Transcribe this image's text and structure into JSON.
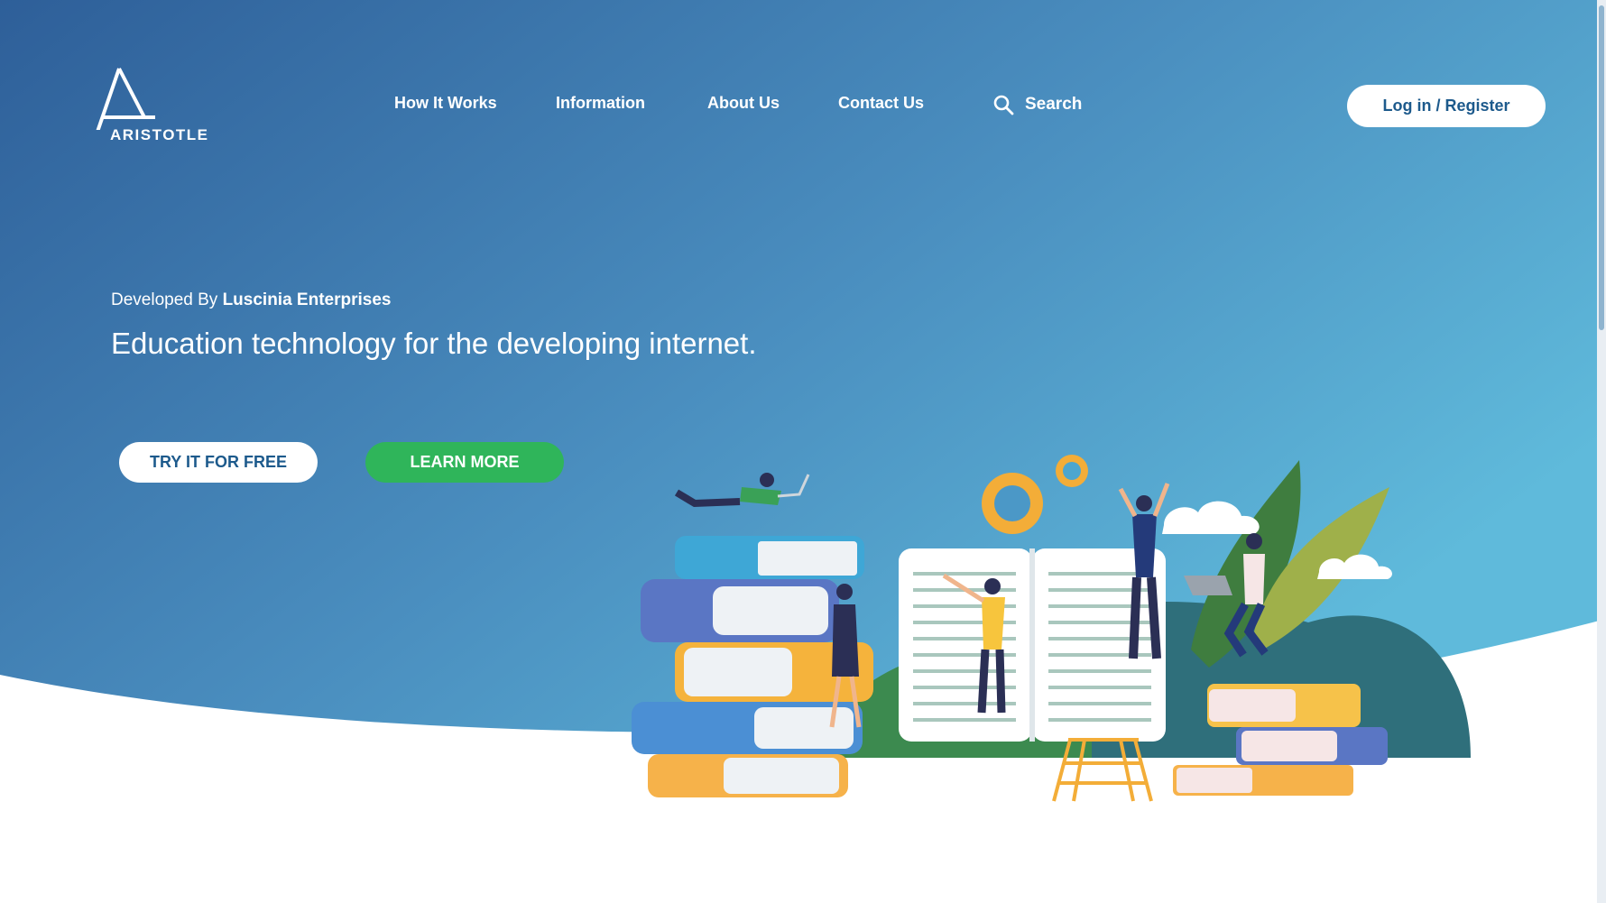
{
  "brand": {
    "name": "ARISTOTLE"
  },
  "nav": {
    "items": [
      {
        "label": "How It Works"
      },
      {
        "label": "Information"
      },
      {
        "label": "About Us"
      },
      {
        "label": "Contact Us"
      }
    ],
    "search_label": "Search",
    "search_icon": "search-icon"
  },
  "auth": {
    "login_label": "Log in / Register"
  },
  "hero": {
    "developed_prefix": "Developed By",
    "developer": "Luscinia Enterprises",
    "headline": "Education technology for the developing internet.",
    "cta_primary": "TRY IT FOR FREE",
    "cta_secondary": "LEARN MORE"
  },
  "colors": {
    "gradient_start": "#2e5f99",
    "gradient_end": "#5bb4d9",
    "accent_green": "#2fb55a",
    "button_text_blue": "#1d5a8c"
  }
}
